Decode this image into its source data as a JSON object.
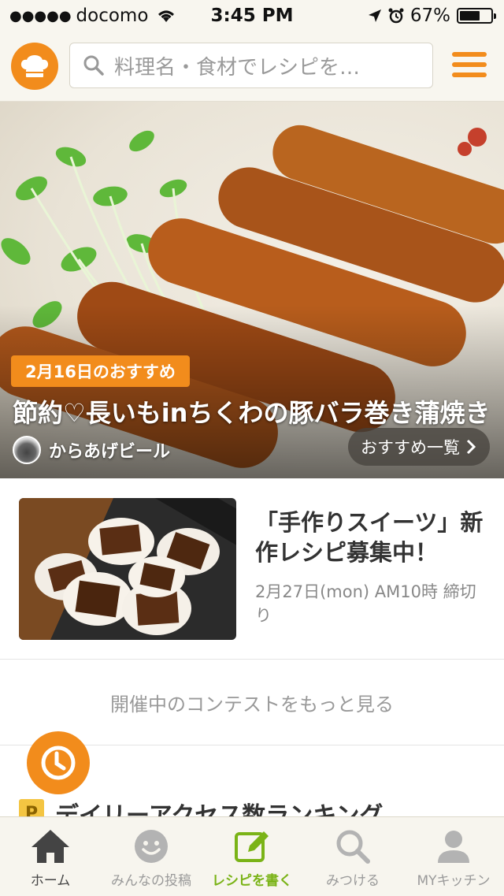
{
  "status_bar": {
    "carrier": "docomo",
    "time": "3:45 PM",
    "battery": "67%",
    "battery_level": 0.67
  },
  "header": {
    "logo_icon": "chef-hat-icon",
    "search_placeholder": "料理名・食材でレシピを…",
    "menu_icon": "hamburger-icon"
  },
  "hero": {
    "badge": "2月16日のおすすめ",
    "title": "節約♡長いもinちくわの豚バラ巻き蒲焼き",
    "author": "からあげビール",
    "list_button": "おすすめ一覧"
  },
  "contest": {
    "title": "「手作りスイーツ」新作レシピ募集中！",
    "deadline": "2月27日(mon) AM10時 締切り"
  },
  "more_contest": "開催中のコンテストをもっと見る",
  "ranking": {
    "icon_letter": "P",
    "title": "デイリーアクセス数ランキング"
  },
  "tabs": [
    {
      "label": "ホーム",
      "icon": "home-icon"
    },
    {
      "label": "みんなの投稿",
      "icon": "smiley-icon"
    },
    {
      "label": "レシピを書く",
      "icon": "edit-icon"
    },
    {
      "label": "みつける",
      "icon": "search-icon"
    },
    {
      "label": "MYキッチン",
      "icon": "person-icon"
    }
  ],
  "colors": {
    "accent": "#f28c1c",
    "write_green": "#7ab317"
  }
}
